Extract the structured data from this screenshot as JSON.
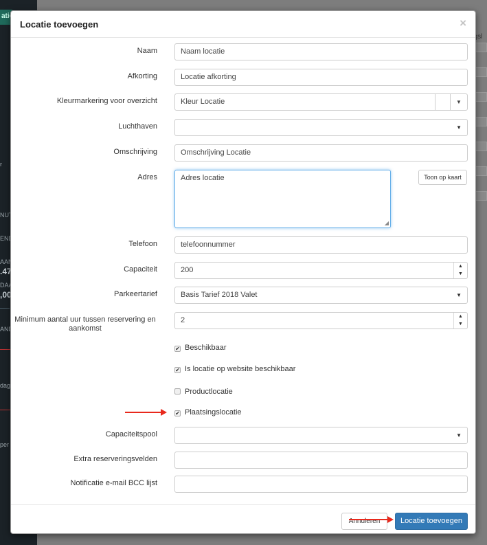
{
  "background": {
    "sidebar_badge": "atie",
    "sidebar_texts": [
      "r",
      "NUTE",
      "END",
      "AAND",
      "DAA"
    ],
    "sidebar_values": [
      ".47",
      ",00"
    ],
    "sidebar_small": [
      "AND",
      "dag",
      "per"
    ],
    "right_text": "ngsl"
  },
  "modal": {
    "title": "Locatie toevoegen",
    "close": "×"
  },
  "form": {
    "naam_label": "Naam",
    "naam_value": "Naam locatie",
    "afkorting_label": "Afkorting",
    "afkorting_value": "Locatie afkorting",
    "kleur_label": "Kleurmarkering voor overzicht",
    "kleur_value": "Kleur Locatie",
    "luchthaven_label": "Luchthaven",
    "luchthaven_value": "",
    "omschrijving_label": "Omschrijving",
    "omschrijving_value": "Omschrijving Locatie",
    "adres_label": "Adres",
    "adres_value": "Adres locatie",
    "toon_kaart": "Toon op kaart",
    "telefoon_label": "Telefoon",
    "telefoon_value": "telefoonnummer",
    "capaciteit_label": "Capaciteit",
    "capaciteit_value": "200",
    "parkeertarief_label": "Parkeertarief",
    "parkeertarief_value": "Basis Tarief 2018 Valet",
    "minimum_label": "Minimum aantal uur tussen reservering en aankomst",
    "minimum_value": "2",
    "checkboxes": [
      {
        "label": "Beschikbaar",
        "checked": true
      },
      {
        "label": "Is locatie op website beschikbaar",
        "checked": true
      },
      {
        "label": "Productlocatie",
        "checked": false
      },
      {
        "label": "Plaatsingslocatie",
        "checked": true
      }
    ],
    "capaciteitspool_label": "Capaciteitspool",
    "capaciteitspool_value": "",
    "extra_label": "Extra reserveringsvelden",
    "extra_value": "",
    "bcc_label": "Notificatie e-mail BCC lijst",
    "bcc_value": ""
  },
  "footer": {
    "cancel_label": "Annuleren",
    "submit_label": "Locatie toevoegen"
  },
  "glyphs": {
    "caret": "▼",
    "up": "▲",
    "down": "▼",
    "check": "✔",
    "resize": "◢"
  },
  "colors": {
    "primary": "#337ab7",
    "annotation_arrow": "#e8291c"
  }
}
